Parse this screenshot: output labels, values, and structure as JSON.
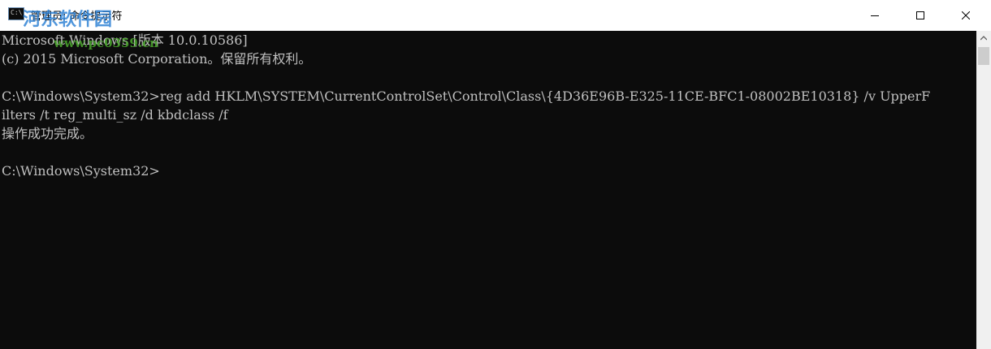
{
  "window": {
    "title": "管理员: 命令提示符",
    "watermark": "河东软件园",
    "watermark_url": "www.pc0359.cn",
    "controls": {
      "minimize": "minimize-icon",
      "maximize": "maximize-icon",
      "close": "close-icon"
    }
  },
  "console": {
    "lines": [
      "Microsoft Windows [版本 10.0.10586]",
      "(c) 2015 Microsoft Corporation。保留所有权利。",
      "",
      "C:\\Windows\\System32>reg add HKLM\\SYSTEM\\CurrentControlSet\\Control\\Class\\{4D36E96B-E325-11CE-BFC1-08002BE10318} /v UpperF",
      "ilters /t reg_multi_sz /d kbdclass /f",
      "操作成功完成。",
      "",
      "C:\\Windows\\System32>"
    ]
  },
  "colors": {
    "console_bg": "#0c0c0c",
    "console_text": "#c0c0c0",
    "titlebar_bg": "#ffffff"
  }
}
